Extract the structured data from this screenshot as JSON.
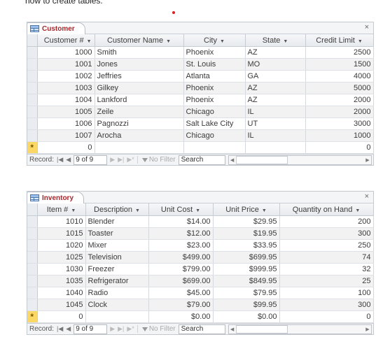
{
  "intro_text": "how to create tables.",
  "customer": {
    "tab_label": "Customer",
    "close_glyph": "×",
    "columns": [
      "Customer #",
      "Customer Name",
      "City",
      "State",
      "Credit Limit"
    ],
    "rows": [
      [
        "1000",
        "Smith",
        "Phoenix",
        "AZ",
        "2500"
      ],
      [
        "1001",
        "Jones",
        "St. Louis",
        "MO",
        "1500"
      ],
      [
        "1002",
        "Jeffries",
        "Atlanta",
        "GA",
        "4000"
      ],
      [
        "1003",
        "Gilkey",
        "Phoenix",
        "AZ",
        "5000"
      ],
      [
        "1004",
        "Lankford",
        "Phoenix",
        "AZ",
        "2000"
      ],
      [
        "1005",
        "Zeile",
        "Chicago",
        "IL",
        "2000"
      ],
      [
        "1006",
        "Pagnozzi",
        "Salt Lake City",
        "UT",
        "3000"
      ],
      [
        "1007",
        "Arocha",
        "Chicago",
        "IL",
        "1000"
      ]
    ],
    "new_row": [
      "0",
      "",
      "",
      "",
      "0"
    ],
    "new_row_marker": "*",
    "nav": {
      "label": "Record:",
      "current": "9 of 9",
      "no_filter": "No Filter",
      "search": "Search"
    }
  },
  "inventory": {
    "tab_label": "Inventory",
    "close_glyph": "×",
    "columns": [
      "Item #",
      "Description",
      "Unit Cost",
      "Unit Price",
      "Quantity on Hand"
    ],
    "rows": [
      [
        "1010",
        "Blender",
        "$14.00",
        "$29.95",
        "200"
      ],
      [
        "1015",
        "Toaster",
        "$12.00",
        "$19.95",
        "300"
      ],
      [
        "1020",
        "Mixer",
        "$23.00",
        "$33.95",
        "250"
      ],
      [
        "1025",
        "Television",
        "$499.00",
        "$699.95",
        "74"
      ],
      [
        "1030",
        "Freezer",
        "$799.00",
        "$999.95",
        "32"
      ],
      [
        "1035",
        "Refrigerator",
        "$699.00",
        "$849.95",
        "25"
      ],
      [
        "1040",
        "Radio",
        "$45.00",
        "$79.95",
        "100"
      ],
      [
        "1045",
        "Clock",
        "$79.00",
        "$99.95",
        "300"
      ]
    ],
    "new_row": [
      "0",
      "",
      "$0.00",
      "$0.00",
      "0"
    ],
    "new_row_marker": "*",
    "nav": {
      "label": "Record:",
      "current": "9 of 9",
      "no_filter": "No Filter",
      "search": "Search"
    }
  },
  "colors": {
    "tab_label": "#a8262b",
    "new_row_marker_bg": "#fbd865",
    "alt_row": "#f2f2f2"
  }
}
